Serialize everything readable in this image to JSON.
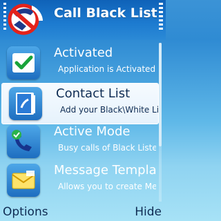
{
  "titlebar": {
    "title": "Call Black List"
  },
  "list": [
    {
      "title": "Activated",
      "subtitle": "Application is Activated",
      "icon": "checkmark-icon"
    },
    {
      "title": "Contact List",
      "subtitle": "Add your Black\\White Liste",
      "icon": "contacts-book-icon",
      "selected": true
    },
    {
      "title": "Active Mode",
      "subtitle": "Busy calls of Black Liste",
      "icon": "phone-checkmark-icon"
    },
    {
      "title": "Message Templa…",
      "subtitle": "Allows you to create Me…",
      "icon": "envelope-icon"
    }
  ],
  "softkeys": {
    "left": "Options",
    "right": "Hide"
  },
  "colors": {
    "titlebar": "#1d7bd0",
    "background_top": "#3b93d6",
    "background_bottom": "#a7e2f6",
    "selection": "#f6fbff",
    "softkey_text": "#0f2c53"
  }
}
